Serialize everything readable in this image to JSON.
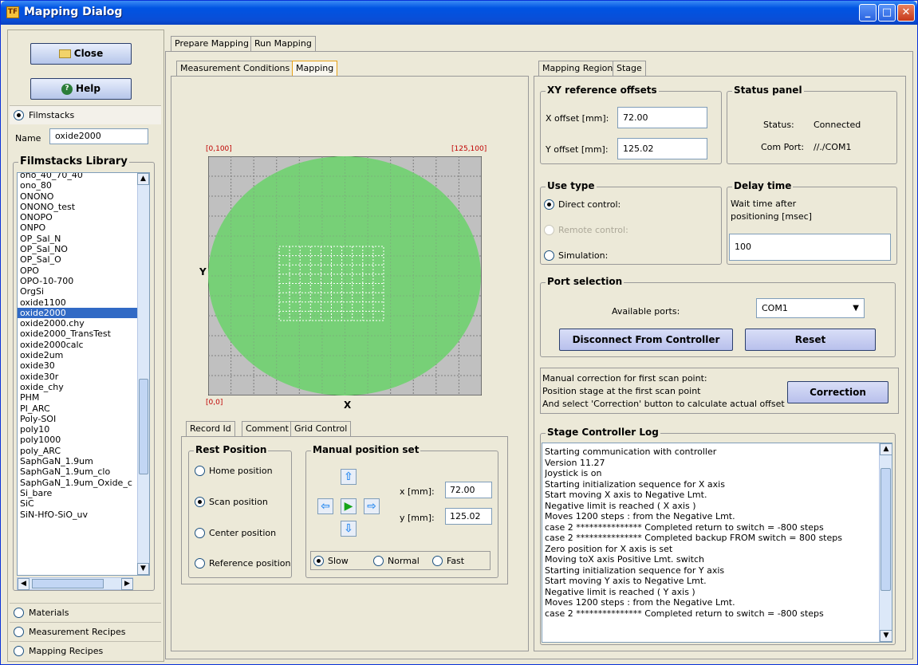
{
  "window": {
    "title": "Mapping Dialog",
    "icon_text": "TF"
  },
  "left": {
    "close_label": "Close",
    "help_label": "Help",
    "filmstacks_label": "Filmstacks",
    "name_label": "Name",
    "name_value": "oxide2000",
    "library_title": "Filmstacks Library",
    "library_items": [
      "ono_40_70_40",
      "ono_80",
      "ONONO",
      "ONONO_test",
      "ONOPO",
      "ONPO",
      "OP_Sal_N",
      "OP_Sal_NO",
      "OP_Sal_O",
      "OPO",
      "OPO-10-700",
      "OrgSi",
      "oxide1100",
      "oxide2000",
      "oxide2000.chy",
      "oxide2000_TransTest",
      "oxide2000calc",
      "oxide2um",
      "oxide30",
      "oxide30r",
      "oxide_chy",
      "PHM",
      "PI_ARC",
      "Poly-SOI",
      "poly10",
      "poly1000",
      "poly_ARC",
      "SaphGaN_1.9um",
      "SaphGaN_1.9um_clo",
      "SaphGaN_1.9um_Oxide_c",
      "Si_bare",
      "SiC",
      "SiN-HfO-SiO_uv"
    ],
    "selected_item": "oxide2000",
    "materials_label": "Materials",
    "measurement_recipes_label": "Measurement Recipes",
    "mapping_recipes_label": "Mapping Recipes"
  },
  "main_tabs": [
    "Prepare Mapping",
    "Run Mapping"
  ],
  "sub_tabs": [
    "Measurement Conditions",
    "Mapping"
  ],
  "map": {
    "top_left": "[0,100]",
    "top_right": "[125,100]",
    "bottom_left": "[0,0]",
    "x_label": "X",
    "y_label": "Y",
    "grid_color": "#808080",
    "wafer_color": "#77d077"
  },
  "lower_tabs": [
    "Record Id",
    "Comment",
    "Grid Control"
  ],
  "rest_position": {
    "title": "Rest Position",
    "options": [
      "Home position",
      "Scan position",
      "Center position",
      "Reference position"
    ],
    "selected": "Scan position"
  },
  "manual_position": {
    "title": "Manual position set",
    "x_label": "x [mm]:",
    "x_value": "72.00",
    "y_label": "y [mm]:",
    "y_value": "125.02",
    "speeds": [
      "Slow",
      "Normal",
      "Fast"
    ],
    "selected_speed": "Slow"
  },
  "right_tabs": [
    "Mapping Region",
    "Stage"
  ],
  "xy_offsets": {
    "title": "XY reference offsets",
    "x_label": "X offset [mm]:",
    "x_value": "72.00",
    "y_label": "Y offset [mm]:",
    "y_value": "125.02"
  },
  "status_panel": {
    "title": "Status panel",
    "status_label": "Status:",
    "status_value": "Connected",
    "port_label": "Com Port:",
    "port_value": "//./COM1"
  },
  "use_type": {
    "title": "Use type",
    "options": [
      "Direct control:",
      "Remote control:",
      "Simulation:"
    ],
    "selected": "Direct control:"
  },
  "delay_time": {
    "title": "Delay time",
    "desc_line1": "Wait time after",
    "desc_line2": "positioning [msec]",
    "value": "100"
  },
  "port_selection": {
    "title": "Port selection",
    "available_label": "Available ports:",
    "selected_port": "COM1",
    "disconnect_label": "Disconnect From Controller",
    "reset_label": "Reset"
  },
  "correction": {
    "line1": "Manual correction for first scan point:",
    "line2": "Position stage at the first scan point",
    "line3": "And select 'Correction' button to calculate actual offset",
    "button_label": "Correction"
  },
  "log": {
    "title": "Stage Controller Log",
    "lines": [
      "Starting communication with controller",
      "Version 11.27",
      "Joystick is on",
      "Starting initialization sequence for X axis",
      "Start moving X axis to Negative Lmt.",
      "Negative limit is reached ( X axis )",
      "Moves 1200 steps : from the Negative Lmt.",
      " case 2 *************** Completed return to switch = -800 steps",
      " case 2 *************** Completed backup FROM switch = 800 steps",
      "Zero position for X axis is set",
      "Moving toX axis Positive Lmt. switch",
      "Starting initialization sequence for Y axis",
      "Start moving Y axis to Negative Lmt.",
      "Negative limit is reached ( Y axis )",
      "Moves 1200 steps : from the Negative Lmt.",
      " case 2 *************** Completed return to switch = -800 steps"
    ]
  }
}
